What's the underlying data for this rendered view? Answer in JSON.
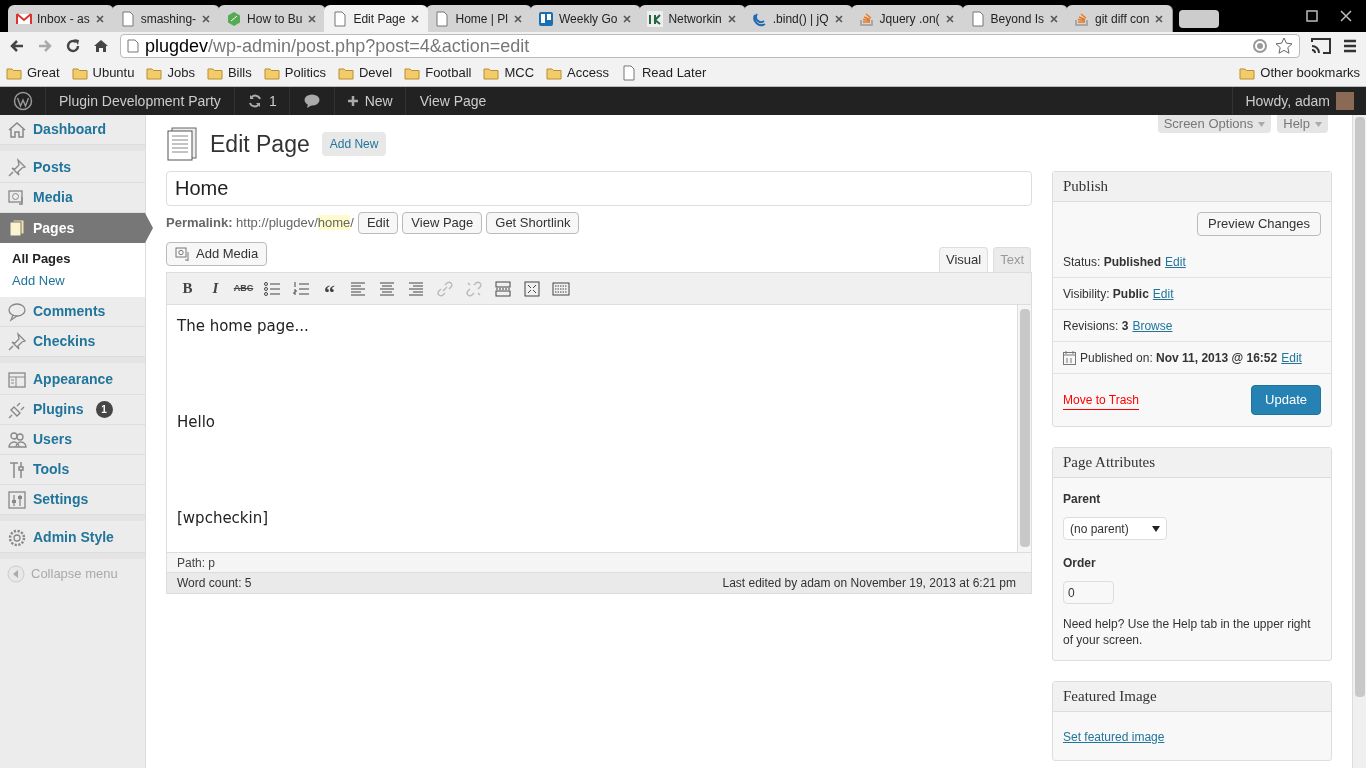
{
  "browser": {
    "tabs": [
      {
        "title": "Inbox - as",
        "selected": false
      },
      {
        "title": "smashing-",
        "selected": false
      },
      {
        "title": "How to Bu",
        "selected": false
      },
      {
        "title": "Edit Page",
        "selected": true
      },
      {
        "title": "Home | Pl",
        "selected": false
      },
      {
        "title": "Weekly Go",
        "selected": false
      },
      {
        "title": "Networkin",
        "selected": false
      },
      {
        "title": ".bind() | jQ",
        "selected": false
      },
      {
        "title": "Jquery .on(",
        "selected": false
      },
      {
        "title": "Beyond Is",
        "selected": false
      },
      {
        "title": "git diff con",
        "selected": false
      }
    ],
    "url_host": "plugdev",
    "url_path": "/wp-admin/post.php?post=4&action=edit",
    "bookmarks": [
      {
        "label": "Great",
        "kind": "folder"
      },
      {
        "label": "Ubuntu",
        "kind": "folder"
      },
      {
        "label": "Jobs",
        "kind": "folder"
      },
      {
        "label": "Bills",
        "kind": "folder"
      },
      {
        "label": "Politics",
        "kind": "folder"
      },
      {
        "label": "Devel",
        "kind": "folder"
      },
      {
        "label": "Football",
        "kind": "folder"
      },
      {
        "label": "MCC",
        "kind": "folder"
      },
      {
        "label": "Access",
        "kind": "folder"
      },
      {
        "label": "Read Later",
        "kind": "page"
      }
    ],
    "other_bookmarks": "Other bookmarks"
  },
  "admin_bar": {
    "site": "Plugin Development Party",
    "updates": "1",
    "new": "New",
    "view": "View Page",
    "howdy": "Howdy, adam"
  },
  "sidebar": {
    "groups": [
      [
        {
          "label": "Dashboard",
          "selected": false
        }
      ],
      [
        {
          "label": "Posts",
          "selected": false
        },
        {
          "label": "Media",
          "selected": false
        },
        {
          "label": "Pages",
          "selected": true,
          "children": [
            {
              "label": "All Pages",
              "selected": true
            },
            {
              "label": "Add New",
              "selected": false
            }
          ]
        },
        {
          "label": "Comments",
          "selected": false
        },
        {
          "label": "Checkins",
          "selected": false
        }
      ],
      [
        {
          "label": "Appearance",
          "selected": false
        },
        {
          "label": "Plugins",
          "selected": false,
          "badge": "1"
        },
        {
          "label": "Users",
          "selected": false
        },
        {
          "label": "Tools",
          "selected": false
        },
        {
          "label": "Settings",
          "selected": false
        }
      ],
      [
        {
          "label": "Admin Style",
          "selected": false
        }
      ]
    ],
    "collapse": "Collapse menu"
  },
  "screen_options": "Screen Options",
  "help": "Help",
  "heading": "Edit Page",
  "add_new": "Add New",
  "title_value": "Home",
  "permalink": {
    "label": "Permalink:",
    "base": "http://plugdev/",
    "slug": "home",
    "slash": "/",
    "buttons": [
      "Edit",
      "View Page",
      "Get Shortlink"
    ]
  },
  "add_media": "Add Media",
  "editor_tabs": [
    {
      "label": "Visual",
      "selected": true
    },
    {
      "label": "Text",
      "selected": false
    }
  ],
  "toolbar": [
    {
      "kind": "bold",
      "label": "B",
      "disabled": false
    },
    {
      "kind": "italic",
      "label": "I",
      "disabled": false
    },
    {
      "kind": "strike",
      "label": "ABC",
      "disabled": false
    },
    {
      "kind": "ul",
      "disabled": false
    },
    {
      "kind": "ol",
      "disabled": false
    },
    {
      "kind": "quote",
      "label": "“",
      "disabled": false
    },
    {
      "kind": "left",
      "disabled": false
    },
    {
      "kind": "center",
      "disabled": false
    },
    {
      "kind": "right",
      "disabled": false
    },
    {
      "kind": "link",
      "disabled": true
    },
    {
      "kind": "unlink",
      "disabled": true
    },
    {
      "kind": "more",
      "disabled": false
    },
    {
      "kind": "fullscreen",
      "disabled": false
    },
    {
      "kind": "kitchen",
      "disabled": false
    }
  ],
  "content": [
    "The home page...",
    "Hello",
    "[wpcheckin]"
  ],
  "path": "Path: p",
  "word_count": "Word count: 5",
  "last_edited": "Last edited by adam on November 19, 2013 at 6:21 pm",
  "publish": {
    "title": "Publish",
    "preview": "Preview Changes",
    "rows": [
      {
        "label": "Status:",
        "value": "Published",
        "link": "Edit",
        "kind": "plain"
      },
      {
        "label": "Visibility:",
        "value": "Public",
        "link": "Edit",
        "kind": "plain"
      },
      {
        "label": "Revisions:",
        "value": "3",
        "link": "Browse",
        "kind": "plain"
      },
      {
        "label": "Published on:",
        "value": "Nov 11, 2013 @ 16:52",
        "link": "Edit",
        "kind": "calendar"
      }
    ],
    "trash": "Move to Trash",
    "update": "Update"
  },
  "attributes": {
    "title": "Page Attributes",
    "parent_label": "Parent",
    "parent_value": "(no parent)",
    "order_label": "Order",
    "order_value": "0",
    "help": "Need help? Use the Help tab in the upper right of your screen."
  },
  "featured": {
    "title": "Featured Image",
    "link": "Set featured image"
  }
}
